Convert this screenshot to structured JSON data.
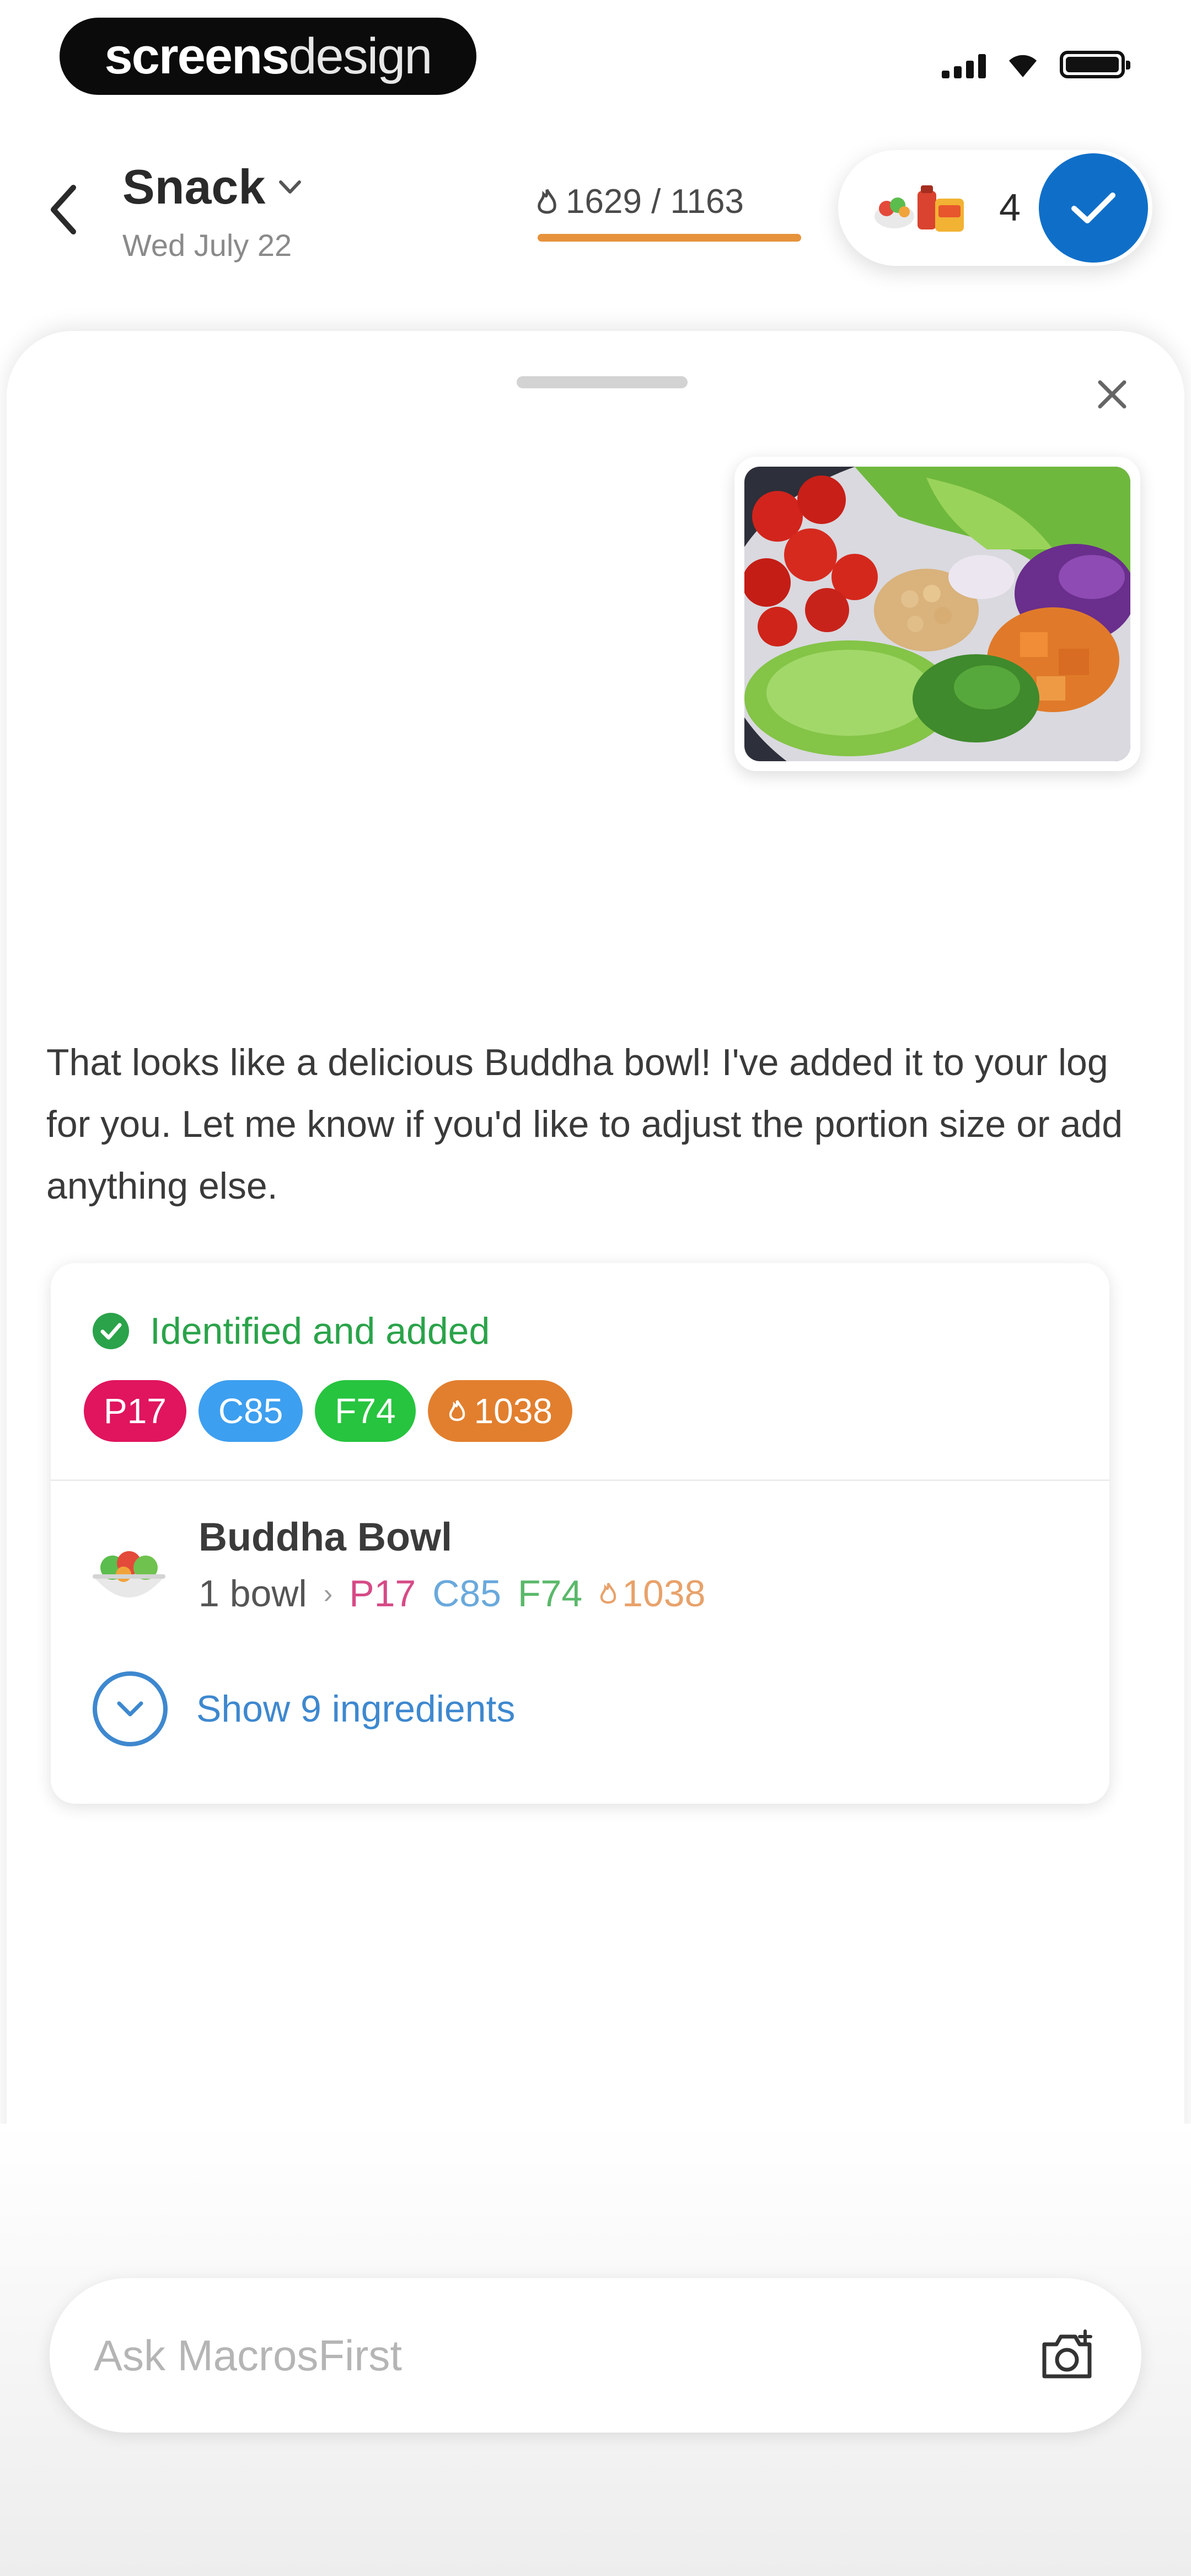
{
  "status_bar": {
    "brand": {
      "part1": "screens",
      "part2": "design"
    },
    "signal_icon": "cellular-signal-icon",
    "wifi_icon": "wifi-icon",
    "battery_icon": "battery-icon"
  },
  "header": {
    "back_icon": "chevron-left-icon",
    "meal": "Snack",
    "meal_dropdown_icon": "chevron-down-icon",
    "date": "Wed July 22",
    "calories": {
      "icon": "flame-icon",
      "text": "1629 / 1163",
      "bar_color": "#e7923c"
    },
    "food_count": "4",
    "food_icons": [
      "salad-icon",
      "drink-icon",
      "snack-box-icon"
    ],
    "confirm_icon": "checkmark-icon",
    "accent_color": "#0f6fc8"
  },
  "sheet": {
    "close_icon": "close-icon",
    "photo": {
      "alt": "photo of a Buddha bowl"
    },
    "reply": "That looks like a delicious Buddha bowl! I've added it to your log for you. Let me know if you'd like to adjust the portion size or add anything else.",
    "card": {
      "status": "Identified and added",
      "status_icon": "check-circle-icon",
      "status_color": "#2aa34a",
      "chips": [
        {
          "label": "P17",
          "color": "#e0155e"
        },
        {
          "label": "C85",
          "color": "#3d9ff0"
        },
        {
          "label": "F74",
          "color": "#27c43f"
        },
        {
          "label": "1038",
          "color": "#e27f2e",
          "icon": "flame-icon"
        }
      ],
      "item": {
        "icon": "salad-bowl-icon",
        "name": "Buddha Bowl",
        "quantity": "1 bowl",
        "separator": "›",
        "macros": [
          {
            "label": "P17",
            "color": "#d64a86"
          },
          {
            "label": "C85",
            "color": "#6aa9dc"
          },
          {
            "label": "F74",
            "color": "#5ab86a"
          },
          {
            "label": "1038",
            "color": "#e8a26b",
            "icon": "flame-icon"
          }
        ]
      },
      "show_ingredients": "Show 9 ingredients",
      "expand_icon": "chevron-down-circle-icon"
    }
  },
  "composer": {
    "placeholder": "Ask MacrosFirst",
    "camera_icon": "camera-icon"
  }
}
